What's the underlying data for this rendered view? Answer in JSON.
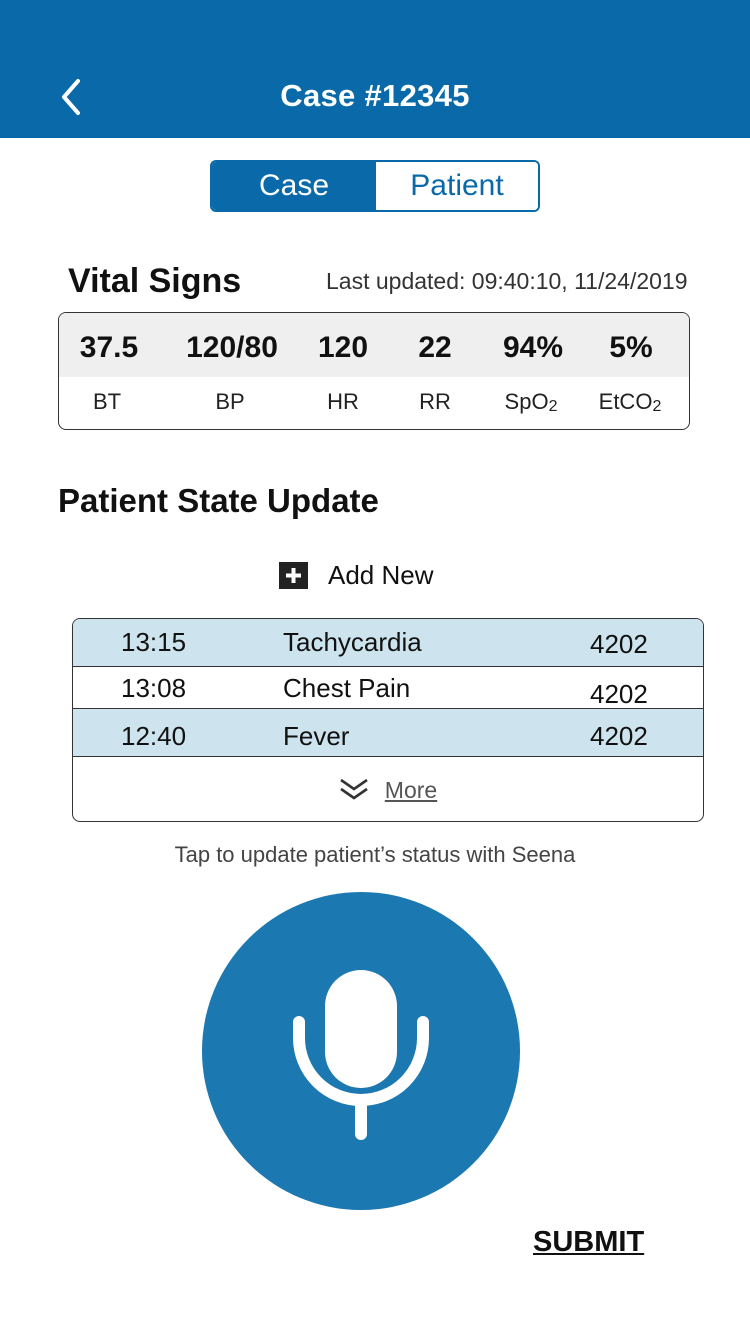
{
  "header": {
    "title": "Case #12345",
    "back_icon": "chevron-left-icon"
  },
  "tabs": [
    {
      "label": "Case",
      "active": true
    },
    {
      "label": "Patient",
      "active": false
    }
  ],
  "vitals": {
    "title": "Vital Signs",
    "last_updated": "Last updated: 09:40:10, 11/24/2019",
    "items": [
      {
        "value": "37.5",
        "label": "BT",
        "label_sub": ""
      },
      {
        "value": "120/80",
        "label": "BP",
        "label_sub": ""
      },
      {
        "value": "120",
        "label": "HR",
        "label_sub": ""
      },
      {
        "value": "22",
        "label": "RR",
        "label_sub": ""
      },
      {
        "value": "94%",
        "label": "SpO",
        "label_sub": "2"
      },
      {
        "value": "5%",
        "label": "EtCO",
        "label_sub": "2"
      }
    ]
  },
  "patient_state": {
    "title": "Patient State Update",
    "add_new_label": "Add New",
    "add_icon": "plus-icon",
    "rows": [
      {
        "time": "13:15",
        "event": "Tachycardia",
        "code": "4202"
      },
      {
        "time": "13:08",
        "event": "Chest Pain",
        "code": "4202"
      },
      {
        "time": "12:40",
        "event": "Fever",
        "code": "4202"
      }
    ],
    "more_label": "More",
    "more_icon": "double-chevron-down-icon"
  },
  "hint": "Tap to update patient’s status with Seena",
  "mic_icon": "microphone-icon",
  "submit_label": "SUBMIT",
  "colors": {
    "primary": "#0a6aa9",
    "mic": "#1c78b0",
    "row_highlight": "#cde3ee"
  }
}
